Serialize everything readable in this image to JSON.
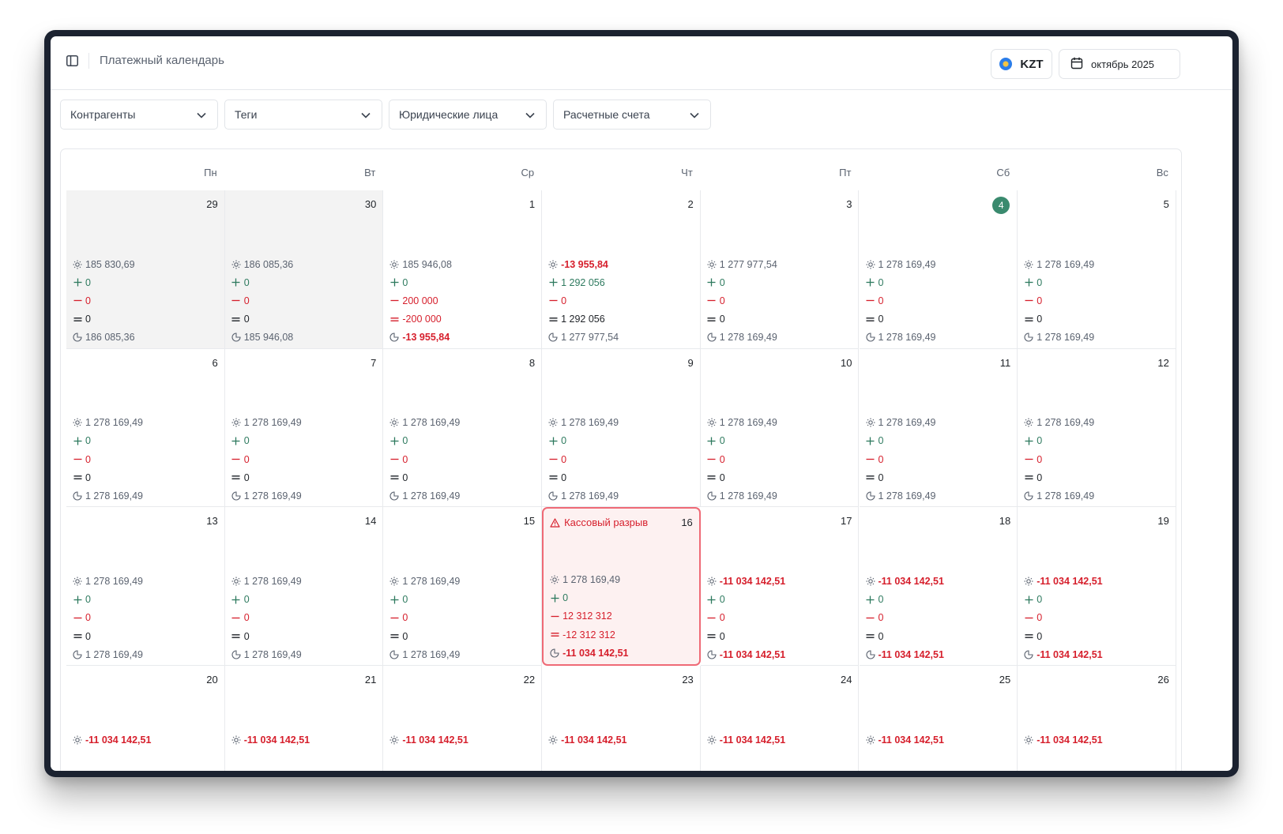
{
  "header": {
    "title": "Платежный календарь",
    "currency": "KZT",
    "period": "октябрь 2025"
  },
  "filters": [
    "Контрагенты",
    "Теги",
    "Юридические лица",
    "Расчетные счета"
  ],
  "weekdays": [
    "Пн",
    "Вт",
    "Ср",
    "Чт",
    "Пт",
    "Сб",
    "Вс"
  ],
  "cash_gap_label": "Кассовый разрыв",
  "colors": {
    "negative": "#d61f2c",
    "positive": "#2e7a5f",
    "today": "#3a8a6e",
    "gap_bg": "#fdf1f1",
    "gap_border": "#ef6a76"
  },
  "days": [
    {
      "day": "29",
      "prev": true,
      "open": "185 830,69",
      "in": "0",
      "out": "0",
      "net": "0",
      "close": "186 085,36"
    },
    {
      "day": "30",
      "prev": true,
      "open": "186 085,36",
      "in": "0",
      "out": "0",
      "net": "0",
      "close": "185 946,08"
    },
    {
      "day": "1",
      "open": "185 946,08",
      "in": "0",
      "out": "200 000",
      "net": "-200 000",
      "net_neg": true,
      "close": "-13 955,84",
      "close_neg": true
    },
    {
      "day": "2",
      "open": "-13 955,84",
      "open_neg": true,
      "in": "1 292 056",
      "out": "0",
      "net": "1 292 056",
      "close": "1 277 977,54"
    },
    {
      "day": "3",
      "open": "1 277 977,54",
      "in": "0",
      "out": "0",
      "net": "0",
      "close": "1 278 169,49"
    },
    {
      "day": "4",
      "today": true,
      "open": "1 278 169,49",
      "in": "0",
      "out": "0",
      "net": "0",
      "close": "1 278 169,49"
    },
    {
      "day": "5",
      "open": "1 278 169,49",
      "in": "0",
      "out": "0",
      "net": "0",
      "close": "1 278 169,49"
    },
    {
      "day": "6",
      "open": "1 278 169,49",
      "in": "0",
      "out": "0",
      "net": "0",
      "close": "1 278 169,49"
    },
    {
      "day": "7",
      "open": "1 278 169,49",
      "in": "0",
      "out": "0",
      "net": "0",
      "close": "1 278 169,49"
    },
    {
      "day": "8",
      "open": "1 278 169,49",
      "in": "0",
      "out": "0",
      "net": "0",
      "close": "1 278 169,49"
    },
    {
      "day": "9",
      "open": "1 278 169,49",
      "in": "0",
      "out": "0",
      "net": "0",
      "close": "1 278 169,49"
    },
    {
      "day": "10",
      "open": "1 278 169,49",
      "in": "0",
      "out": "0",
      "net": "0",
      "close": "1 278 169,49"
    },
    {
      "day": "11",
      "open": "1 278 169,49",
      "in": "0",
      "out": "0",
      "net": "0",
      "close": "1 278 169,49"
    },
    {
      "day": "12",
      "open": "1 278 169,49",
      "in": "0",
      "out": "0",
      "net": "0",
      "close": "1 278 169,49"
    },
    {
      "day": "13",
      "open": "1 278 169,49",
      "in": "0",
      "out": "0",
      "net": "0",
      "close": "1 278 169,49"
    },
    {
      "day": "14",
      "open": "1 278 169,49",
      "in": "0",
      "out": "0",
      "net": "0",
      "close": "1 278 169,49"
    },
    {
      "day": "15",
      "open": "1 278 169,49",
      "in": "0",
      "out": "0",
      "net": "0",
      "close": "1 278 169,49"
    },
    {
      "day": "16",
      "gap": true,
      "open": "1 278 169,49",
      "in": "0",
      "out": "12 312 312",
      "net": "-12 312 312",
      "net_neg": true,
      "close": "-11 034 142,51",
      "close_neg": true
    },
    {
      "day": "17",
      "open": "-11 034 142,51",
      "open_neg": true,
      "in": "0",
      "out": "0",
      "net": "0",
      "close": "-11 034 142,51",
      "close_neg": true
    },
    {
      "day": "18",
      "open": "-11 034 142,51",
      "open_neg": true,
      "in": "0",
      "out": "0",
      "net": "0",
      "close": "-11 034 142,51",
      "close_neg": true
    },
    {
      "day": "19",
      "open": "-11 034 142,51",
      "open_neg": true,
      "in": "0",
      "out": "0",
      "net": "0",
      "close": "-11 034 142,51",
      "close_neg": true
    },
    {
      "day": "20",
      "open": "-11 034 142,51",
      "open_neg": true
    },
    {
      "day": "21",
      "open": "-11 034 142,51",
      "open_neg": true
    },
    {
      "day": "22",
      "open": "-11 034 142,51",
      "open_neg": true
    },
    {
      "day": "23",
      "open": "-11 034 142,51",
      "open_neg": true
    },
    {
      "day": "24",
      "open": "-11 034 142,51",
      "open_neg": true
    },
    {
      "day": "25",
      "open": "-11 034 142,51",
      "open_neg": true
    },
    {
      "day": "26",
      "open": "-11 034 142,51",
      "open_neg": true
    }
  ]
}
